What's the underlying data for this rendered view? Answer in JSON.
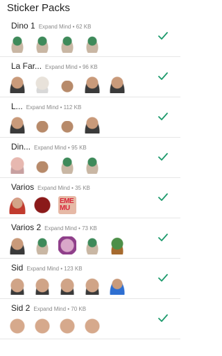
{
  "app_bar": {
    "title": "Sticker Packs"
  },
  "colors": {
    "accent": "#1d9a6c"
  },
  "packs": [
    {
      "title": "Dino 1",
      "meta": "Expand Mind • 62 KB",
      "stickers": [
        "dino",
        "dino",
        "dino",
        "dino"
      ]
    },
    {
      "title": "La Far...",
      "meta": "Expand Mind • 96 KB",
      "stickers": [
        "face",
        "white",
        "meme",
        "face",
        "face"
      ]
    },
    {
      "title": "L...",
      "meta": "Expand Mind • 112 KB",
      "stickers": [
        "face",
        "meme",
        "meme",
        "face"
      ]
    },
    {
      "title": "Din...",
      "meta": "Expand Mind • 95 KB",
      "stickers": [
        "pink",
        "meme",
        "dino",
        "dino"
      ]
    },
    {
      "title": "Varios",
      "meta": "Expand Mind • 35 KB",
      "stickers": [
        "girl",
        "red",
        "poster"
      ]
    },
    {
      "title": "Varios 2",
      "meta": "Expand Mind • 73 KB",
      "stickers": [
        "face",
        "dino",
        "purple",
        "dino",
        "turtle"
      ]
    },
    {
      "title": "Sid",
      "meta": "Expand Mind • 123 KB",
      "stickers": [
        "bald",
        "bald",
        "bald",
        "bald",
        "blue"
      ]
    },
    {
      "title": "Sid 2",
      "meta": "Expand Mind • 70 KB",
      "stickers": [
        "laugh",
        "laugh",
        "laugh",
        "laugh"
      ]
    }
  ],
  "poster_text": "EME MU",
  "check_icon": "check-icon"
}
